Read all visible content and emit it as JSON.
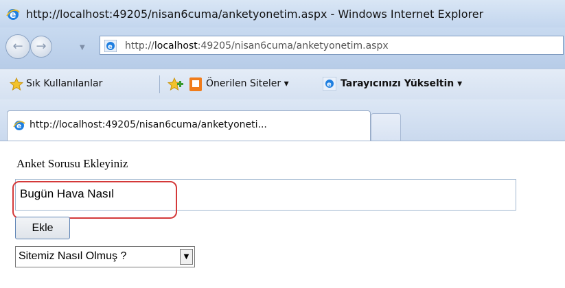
{
  "window": {
    "title": "http://localhost:49205/nisan6cuma/anketyonetim.aspx - Windows Internet Explorer"
  },
  "addressbar": {
    "prefix": "http://",
    "host": "localhost",
    "suffix": ":49205/nisan6cuma/anketyonetim.aspx"
  },
  "favorites": {
    "favorites_label": "Sık Kullanılanlar",
    "suggested_label": "Önerilen Siteler ▾",
    "upgrade_label": "Tarayıcınızı Yükseltin ▾"
  },
  "tabs": {
    "active_label": "http://localhost:49205/nisan6cuma/anketyoneti..."
  },
  "page": {
    "question_label": "Anket Sorusu Ekleyiniz",
    "question_value": "Bugün Hava Nasıl",
    "add_button": "Ekle",
    "survey_select_value": "Sitemiz Nasıl Olmuş ?"
  },
  "icons": {
    "back": "back-arrow-icon",
    "forward": "forward-arrow-icon",
    "ie": "internet-explorer-icon",
    "favorites_star": "favorites-star-icon",
    "add_favorites": "add-favorites-icon",
    "suggested": "suggested-sites-icon",
    "dropdown": "dropdown-arrow-icon"
  },
  "colors": {
    "highlight": "#d43939",
    "button_border": "#5e84b5"
  }
}
